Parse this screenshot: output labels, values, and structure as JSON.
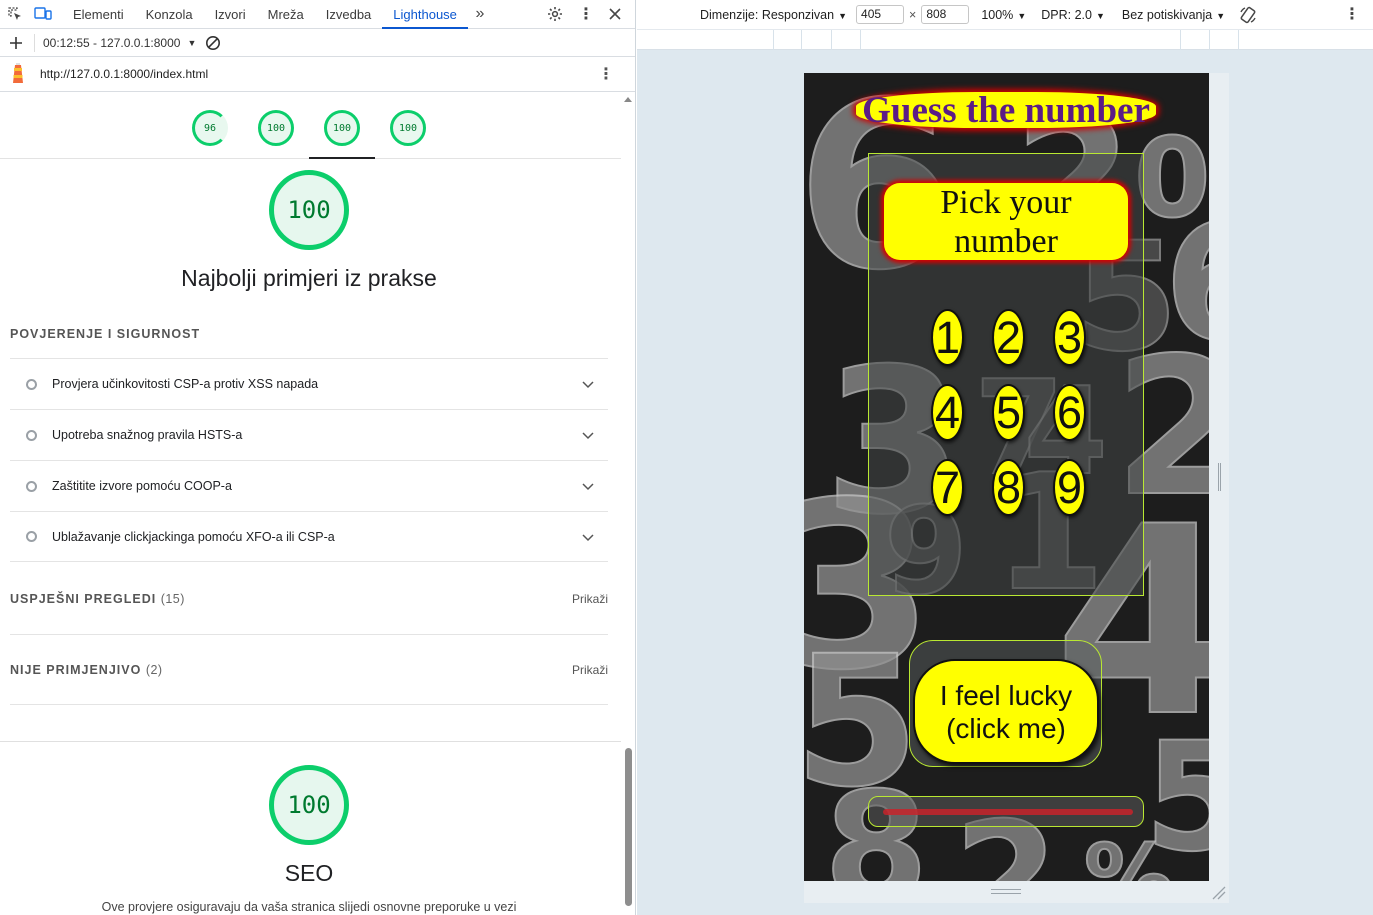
{
  "devtools": {
    "tabs": [
      "Elementi",
      "Konzola",
      "Izvori",
      "Mreža",
      "Izvedba",
      "Lighthouse"
    ],
    "active_tab": "Lighthouse",
    "report_selector": "00:12:55 - 127.0.0.1:8000",
    "report_url": "http://127.0.0.1:8000/index.html",
    "scores": [
      "96",
      "100",
      "100",
      "100"
    ],
    "category": {
      "score": "100",
      "title": "Najbolji primjeri iz prakse",
      "group_title": "POVJERENJE I SIGURNOST",
      "audits": [
        "Provjera učinkovitosti CSP-a protiv XSS napada",
        "Upotreba snažnog pravila HSTS-a",
        "Zaštitite izvore pomoću COOP-a",
        "Ublažavanje clickjackinga pomoću XFO-a ili CSP-a"
      ],
      "clumps": [
        {
          "title": "USPJEŠNI PREGLEDI",
          "count": "(15)",
          "action": "Prikaži"
        },
        {
          "title": "NIJE PRIMJENJIVO",
          "count": "(2)",
          "action": "Prikaži"
        }
      ]
    },
    "seo": {
      "score": "100",
      "title": "SEO",
      "description": "Ove provjere osiguravaju da vaša stranica slijedi osnovne preporuke u vezi"
    }
  },
  "device_toolbar": {
    "dimensions_label": "Dimenzije: Responzivan",
    "width": "405",
    "times": "×",
    "height": "808",
    "zoom": "100%",
    "dpr": "DPR: 2.0",
    "throttling": "Bez potiskivanja"
  },
  "page": {
    "title": "Guess the number",
    "pick_line1": "Pick your",
    "pick_line2": "number",
    "numbers": [
      "1",
      "2",
      "3",
      "4",
      "5",
      "6",
      "7",
      "8",
      "9"
    ],
    "lucky_line1": "I feel lucky",
    "lucky_line2": "(click me)"
  },
  "colors": {
    "accent": "#0b57d0",
    "score_green": "#0cce6b",
    "button_yellow": "#ffff00",
    "title_purple": "#5b1c86"
  }
}
